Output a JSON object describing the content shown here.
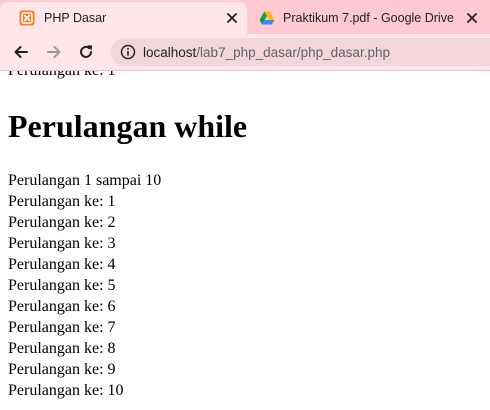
{
  "tabs": [
    {
      "title": "PHP Dasar",
      "favicon": "xampp-icon",
      "active": true
    },
    {
      "title": "Praktikum 7.pdf - Google Drive",
      "favicon": "google-drive-icon",
      "active": false
    }
  ],
  "toolbar": {
    "url_host": "localhost",
    "url_path": "/lab7_php_dasar/php_dasar.php"
  },
  "content": {
    "cut_line": "Perulangan ke: 1",
    "heading": "Perulangan while",
    "intro": "Perulangan 1 sampai 10",
    "lines": [
      "Perulangan ke: 1",
      "Perulangan ke: 2",
      "Perulangan ke: 3",
      "Perulangan ke: 4",
      "Perulangan ke: 5",
      "Perulangan ke: 6",
      "Perulangan ke: 7",
      "Perulangan ke: 8",
      "Perulangan ke: 9",
      "Perulangan ke: 10"
    ]
  },
  "colors": {
    "tabstrip": "#ffc9d1",
    "active_tab": "#ffe6ea",
    "omnibox": "#f2d6db",
    "xampp_orange": "#fb7a24"
  }
}
